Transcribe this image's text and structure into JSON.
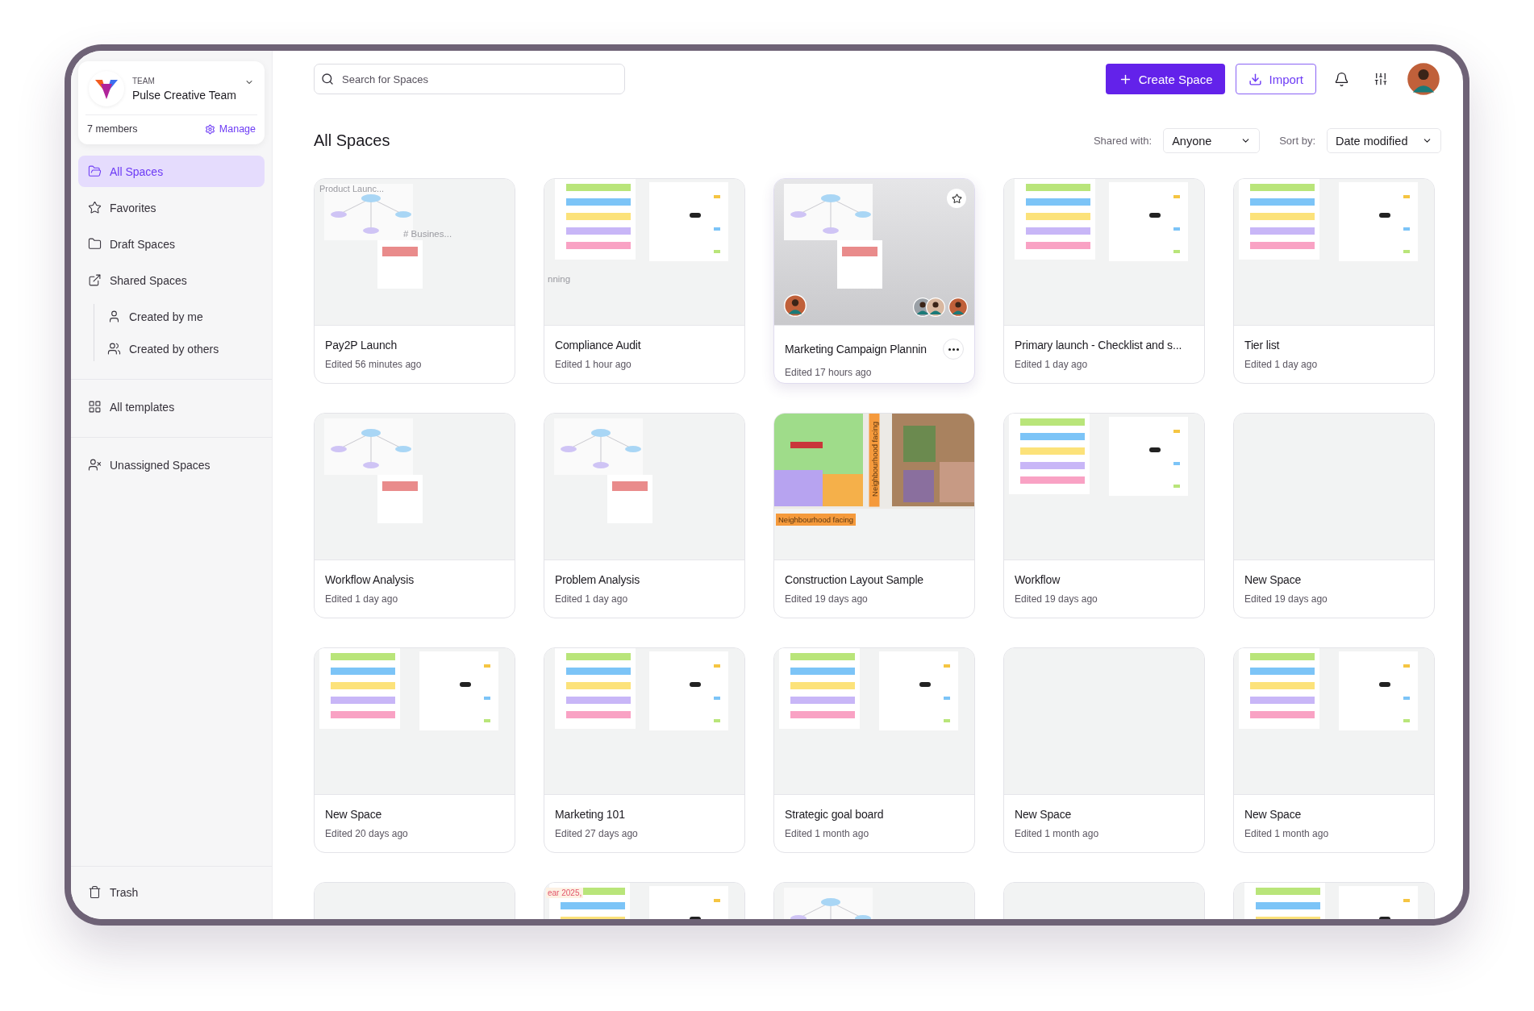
{
  "sidebar": {
    "team": {
      "label": "TEAM",
      "name": "Pulse Creative Team",
      "members": "7 members",
      "manage": "Manage"
    },
    "sections": [
      [
        {
          "kind": "all",
          "label": "All Spaces",
          "selected": true
        },
        {
          "kind": "favorites",
          "label": "Favorites",
          "selected": false
        },
        {
          "kind": "draft",
          "label": "Draft Spaces",
          "selected": false
        },
        {
          "kind": "shared",
          "label": "Shared Spaces",
          "selected": false,
          "children": [
            {
              "kind": "mine",
              "label": "Created by me",
              "selected": false
            },
            {
              "kind": "others",
              "label": "Created by others",
              "selected": false
            }
          ]
        }
      ],
      [
        {
          "kind": "templates",
          "label": "All templates",
          "selected": false
        }
      ],
      [
        {
          "kind": "unassigned",
          "label": "Unassigned Spaces",
          "selected": false
        }
      ]
    ],
    "trash": {
      "kind": "trash",
      "label": "Trash",
      "selected": false
    }
  },
  "header": {
    "search": {
      "placeholder": "Search for Spaces"
    },
    "create": "Create Space",
    "import": "Import"
  },
  "title": "All Spaces",
  "filters": [
    {
      "label": "Shared with:",
      "value": "Anyone"
    },
    {
      "label": "Sort by:",
      "value": "Date modified"
    }
  ],
  "cards": [
    {
      "title": "Pay2P Launch",
      "edited": "Edited 56 minutes ago",
      "hovered": false,
      "thumbnail": {
        "kind": "diagram",
        "labels": [
          {
            "kind": "top-left",
            "text": "Product Launc..."
          },
          {
            "kind": "mid-right",
            "text": "# Busines..."
          }
        ]
      }
    },
    {
      "title": "Compliance Audit",
      "edited": "Edited 1 hour ago",
      "hovered": false,
      "thumbnail": {
        "kind": "board",
        "labels": [
          {
            "kind": "bottom-left",
            "text": "nning"
          }
        ]
      }
    },
    {
      "title": "Marketing Campaign Plannin",
      "edited": "Edited 17 hours ago",
      "hovered": true,
      "thumbnail": {
        "kind": "diagram"
      }
    },
    {
      "title": "Primary launch - Checklist and s...",
      "edited": "Edited 1 day ago",
      "hovered": false,
      "thumbnail": {
        "kind": "board"
      }
    },
    {
      "title": "Tier list",
      "edited": "Edited 1 day ago",
      "hovered": false,
      "thumbnail": {
        "kind": "board"
      }
    },
    {
      "title": "Workflow Analysis",
      "edited": "Edited 1 day ago",
      "hovered": false,
      "thumbnail": {
        "kind": "diagram"
      }
    },
    {
      "title": "Problem Analysis",
      "edited": "Edited 1 day ago",
      "hovered": false,
      "thumbnail": {
        "kind": "diagram"
      }
    },
    {
      "title": "Construction Layout Sample",
      "edited": "Edited 19 days ago",
      "hovered": false,
      "thumbnail": {
        "labels": [
          {
            "kind": "vertical-tag",
            "text": "Neighbourhood facing"
          },
          {
            "kind": "bottom-tag",
            "text": "Neighbourhood facing"
          }
        ]
      }
    },
    {
      "title": "Workflow",
      "edited": "Edited 19 days ago",
      "hovered": false,
      "thumbnail": {
        "kind": "board"
      }
    },
    {
      "title": "New Space",
      "edited": "Edited 19 days ago",
      "hovered": false,
      "thumbnail": {
        "kind": "blank"
      }
    },
    {
      "title": "New Space",
      "edited": "Edited 20 days ago",
      "hovered": false,
      "thumbnail": {
        "kind": "board"
      }
    },
    {
      "title": "Marketing 101",
      "edited": "Edited 27 days ago",
      "hovered": false,
      "thumbnail": {
        "kind": "board"
      }
    },
    {
      "title": "Strategic goal board",
      "edited": "Edited 1 month ago",
      "hovered": false,
      "thumbnail": {
        "kind": "board"
      }
    },
    {
      "title": "New Space",
      "edited": "Edited 1 month ago",
      "hovered": false,
      "thumbnail": {
        "kind": "blank"
      }
    },
    {
      "title": "New Space",
      "edited": "Edited 1 month ago",
      "hovered": false,
      "thumbnail": {
        "kind": "board"
      }
    },
    {
      "hovered": false,
      "thumbnail": {
        "kind": "blank"
      }
    },
    {
      "hovered": false,
      "thumbnail": {
        "kind": "board",
        "labels": [
          {
            "kind": "note",
            "text": "ear 2025,"
          }
        ]
      }
    },
    {
      "hovered": false,
      "thumbnail": {
        "kind": "diagram"
      }
    },
    {
      "hovered": false,
      "thumbnail": {
        "kind": "blank"
      }
    },
    {
      "hovered": false,
      "thumbnail": {
        "kind": "board"
      }
    }
  ]
}
